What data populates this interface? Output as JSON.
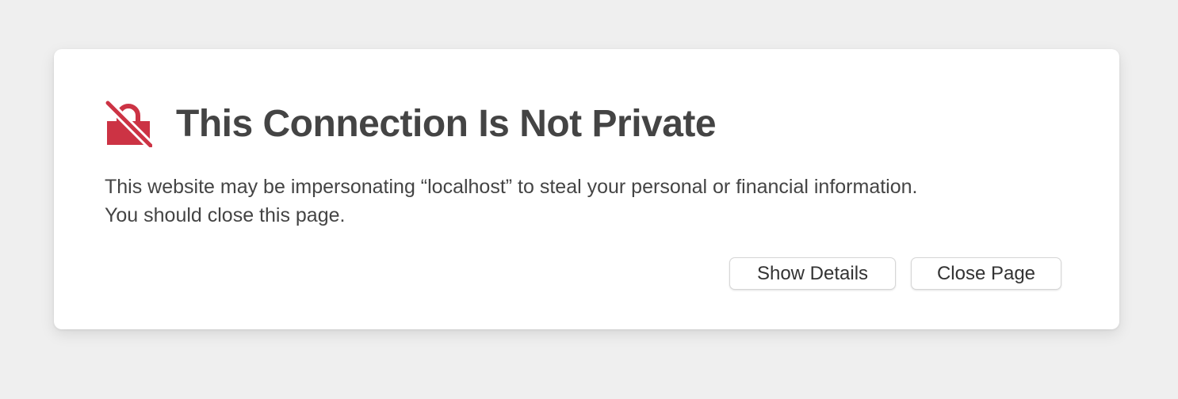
{
  "dialog": {
    "title": "This Connection Is Not Private",
    "message_line1": "This website may be impersonating “localhost” to steal your personal or financial information.",
    "message_line2": "You should close this page.",
    "icon": "broken-lock-icon"
  },
  "buttons": {
    "show_details": "Show Details",
    "close_page": "Close Page"
  },
  "colors": {
    "background": "#efefef",
    "card": "#ffffff",
    "text": "#444444",
    "warning_red": "#cc3344"
  }
}
